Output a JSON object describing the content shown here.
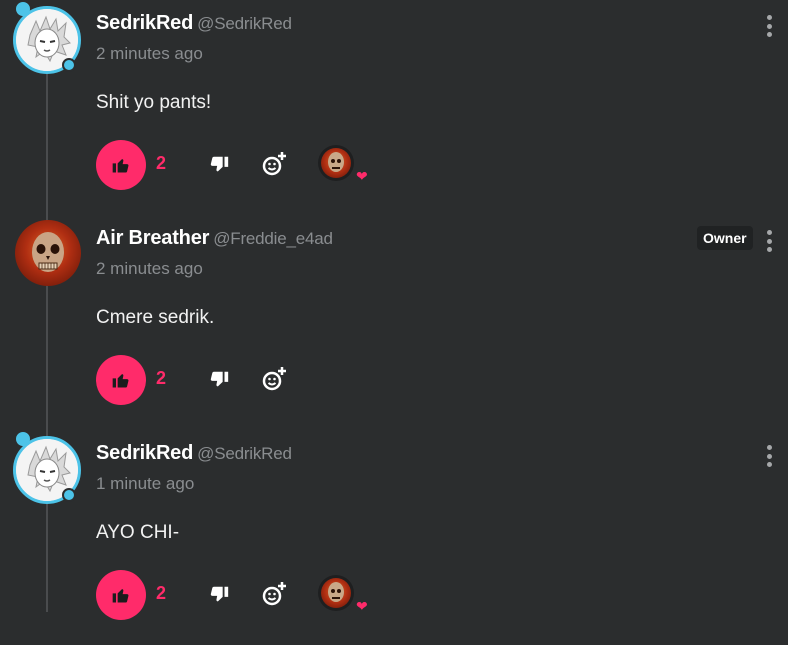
{
  "comments": [
    {
      "name": "SedrikRed",
      "handle": "@SedrikRed",
      "time": "2 minutes ago",
      "text": "Shit yo pants!",
      "likes": "2",
      "has_reaction": true,
      "owner": false
    },
    {
      "name": "Air Breather",
      "handle": "@Freddie_e4ad",
      "time": "2 minutes ago",
      "text": "Cmere sedrik.",
      "likes": "2",
      "has_reaction": false,
      "owner": true,
      "owner_label": "Owner"
    },
    {
      "name": "SedrikRed",
      "handle": "@SedrikRed",
      "time": "1 minute ago",
      "text": "AYO CHI-",
      "likes": "2",
      "has_reaction": true,
      "owner": false
    }
  ],
  "icons": {
    "like": "thumbs-up-icon",
    "dislike": "thumbs-down-icon",
    "react": "add-reaction-icon",
    "more": "more-vertical-icon",
    "heart": "heart-icon"
  },
  "colors": {
    "background": "#2b2d2e",
    "accent": "#ff2b6a",
    "muted": "#8a8d90",
    "avatar_ring": "#4cc3e8"
  }
}
